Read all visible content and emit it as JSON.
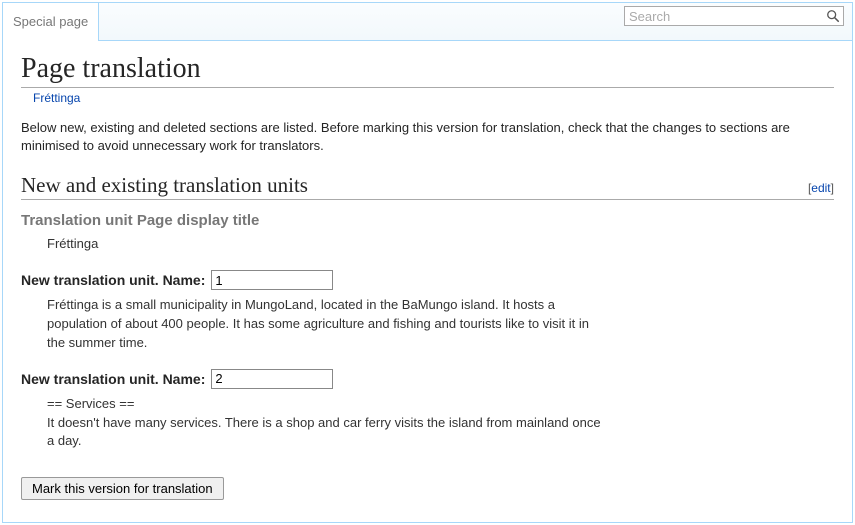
{
  "tab_label": "Special page",
  "search": {
    "placeholder": "Search"
  },
  "page_title": "Page translation",
  "subtitle_link": "Fréttinga",
  "intro": "Below new, existing and deleted sections are listed. Before marking this version for translation, check that the changes to sections are minimised to avoid unnecessary work for translators.",
  "section_heading": "New and existing translation units",
  "edit_label": "edit",
  "display_title_unit": {
    "header": "Translation unit Page display title",
    "value": "Fréttinga"
  },
  "new_unit_prefix": "New translation unit. Name:",
  "units": [
    {
      "name_value": "1",
      "text": "Fréttinga is a small municipality in MungoLand, located in the BaMungo island. It hosts a population of about 400 people. It has some agriculture and fishing and tourists like to visit it in the summer time."
    },
    {
      "name_value": "2",
      "text": "== Services ==\nIt doesn't have many services. There is a shop and car ferry visits the island from mainland once a day."
    }
  ],
  "mark_button": "Mark this version for translation"
}
